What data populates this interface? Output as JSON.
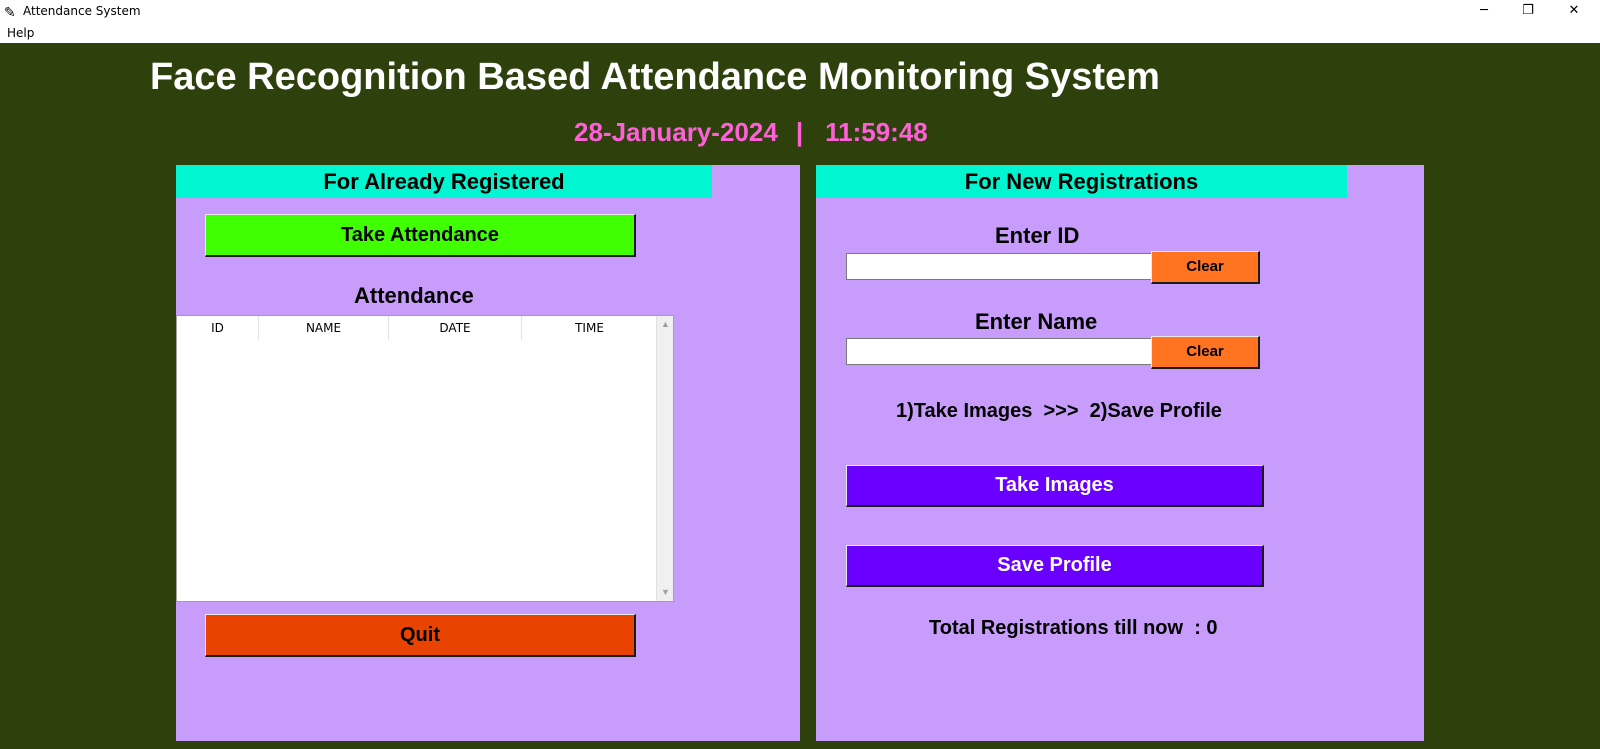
{
  "window": {
    "title": "Attendance System",
    "controls": {
      "minimize": "─",
      "maximize": "❐",
      "close": "✕"
    }
  },
  "menu": {
    "help": "Help"
  },
  "header": {
    "title": "Face Recognition Based Attendance Monitoring System",
    "date": "28-January-2024",
    "separator": "|",
    "time": "11:59:48"
  },
  "left_panel": {
    "header": "For Already Registered",
    "take_attendance_label": "Take Attendance",
    "attendance_label": "Attendance",
    "table": {
      "columns": [
        "ID",
        "NAME",
        "DATE",
        "TIME"
      ],
      "rows": []
    },
    "quit_label": "Quit"
  },
  "right_panel": {
    "header": "For New Registrations",
    "id_label": "Enter ID",
    "id_value": "",
    "clear_id_label": "Clear",
    "name_label": "Enter Name",
    "name_value": "",
    "clear_name_label": "Clear",
    "steps_text": "1)Take Images  >>>  2)Save Profile",
    "take_images_label": "Take Images",
    "save_profile_label": "Save Profile",
    "total_registrations": "Total Registrations till now  : 0"
  },
  "colors": {
    "background": "#2e410d",
    "panel": "#c79cfa",
    "panel_header": "#00f5d0",
    "datetime": "#ff60d8",
    "take_attendance": "#3fff00",
    "quit": "#e84400",
    "clear": "#ff7321",
    "primary_action": "#6a00ff"
  },
  "icons": {
    "app": "feather-icon",
    "scroll_up": "triangle-up-icon",
    "scroll_down": "triangle-down-icon"
  }
}
